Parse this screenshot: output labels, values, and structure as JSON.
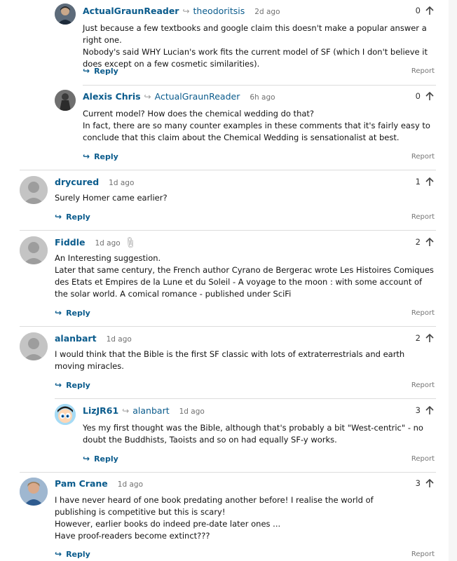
{
  "comments": [
    {
      "author": "ActualGraunReader",
      "reply_to": "theodoritsis",
      "time": "2d ago",
      "votes": "0",
      "paragraphs": [
        "Just because a few textbooks and google claim this doesn't make a popular answer a right one.",
        "Nobody's said WHY Lucian's work fits the current model of SF (which I don't believe it does except on a few cosmetic similarities)."
      ],
      "reply_label": "Reply",
      "report_label": "Report",
      "avatar": "photo-man-dark-hair"
    },
    {
      "author": "Alexis Chris",
      "reply_to": "ActualGraunReader",
      "time": "6h ago",
      "votes": "0",
      "paragraphs": [
        "Current model? How does the chemical wedding do that?",
        "In fact, there are so many counter examples in these comments that it's fairly easy to conclude that this claim about the Chemical Wedding is sensationalist at best."
      ],
      "reply_label": "Reply",
      "report_label": "Report",
      "avatar": "photo-dark-figure"
    },
    {
      "author": "drycured",
      "time": "1d ago",
      "votes": "1",
      "paragraphs": [
        "Surely Homer came earlier?"
      ],
      "reply_label": "Reply",
      "report_label": "Report",
      "avatar": "default-avatar"
    },
    {
      "author": "Fiddle",
      "time": "1d ago",
      "votes": "2",
      "paragraphs": [
        "An Interesting suggestion.",
        "Later that same century, the French author Cyrano de Bergerac wrote Les Histoires Comiques des Etats et Empires de la Lune et du Soleil - A voyage to the moon : with some account of the solar world. A comical romance - published under SciFi"
      ],
      "reply_label": "Reply",
      "report_label": "Report",
      "avatar": "default-avatar",
      "has_attachment_icon": true
    },
    {
      "author": "alanbart",
      "time": "1d ago",
      "votes": "2",
      "paragraphs": [
        "I would think that the Bible is the first SF classic with lots of extraterrestrials and earth moving miracles."
      ],
      "reply_label": "Reply",
      "report_label": "Report",
      "avatar": "default-avatar"
    },
    {
      "author": "LizJR61",
      "reply_to": "alanbart",
      "time": "1d ago",
      "votes": "3",
      "paragraphs": [
        "Yes my first thought was the Bible, although that's probably a bit \"West-centric\" - no doubt the Buddhists, Taoists and so on had equally SF-y works."
      ],
      "reply_label": "Reply",
      "report_label": "Report",
      "avatar": "cartoon-character"
    },
    {
      "author": "Pam Crane",
      "time": "1d ago",
      "votes": "3",
      "paragraphs": [
        "I have never heard of one book predating another before! I realise the world of publishing is competitive but this is scary!",
        "However, earlier books do indeed pre-date later ones ...",
        "Have proof-readers become extinct???"
      ],
      "reply_label": "Reply",
      "report_label": "Report",
      "avatar": "photo-woman"
    }
  ],
  "colors": {
    "author": "#0a5b8c",
    "reply": "#0a5b8c",
    "meta": "#707070",
    "divider": "#dcdcdc",
    "background": "#ffffff",
    "gutter": "#f6f6f6"
  },
  "icons": {
    "reply_to": "reply-to-arrow-icon",
    "upvote": "upvote-arrow-icon",
    "reply": "reply-arrow-icon",
    "attachment": "paperclip-icon"
  }
}
